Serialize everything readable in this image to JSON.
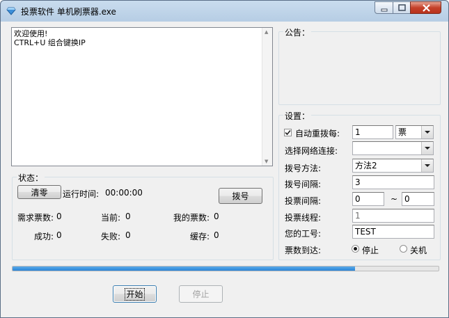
{
  "window": {
    "title": "投票软件 单机刷票器.exe",
    "accent": "#2a84d6"
  },
  "log": {
    "lines": "欢迎使用!\nCTRL+U 组合键换IP"
  },
  "announcement": {
    "label": "公告："
  },
  "status": {
    "label": "状态：",
    "clear_button": "清零",
    "runtime_label": "运行时间:",
    "runtime_value": "00:00:00",
    "dial_button": "拨号",
    "required_votes_label": "需求票数:",
    "required_votes_value": "0",
    "current_label": "当前:",
    "current_value": "0",
    "my_votes_label": "我的票数:",
    "my_votes_value": "0",
    "success_label": "成功:",
    "success_value": "0",
    "fail_label": "失败:",
    "fail_value": "0",
    "cache_label": "缓存:",
    "cache_value": "0"
  },
  "settings": {
    "label": "设置：",
    "auto_redial_label": "自动重拨每:",
    "auto_redial_checked": true,
    "auto_redial_value": "1",
    "auto_redial_unit": "票",
    "network_label": "选择网络连接:",
    "network_value": "",
    "dial_method_label": "拨号方法:",
    "dial_method_value": "方法2",
    "dial_interval_label": "拨号间隔:",
    "dial_interval_value": "3",
    "vote_interval_label": "投票间隔:",
    "vote_interval_min": "0",
    "vote_interval_sep": "~",
    "vote_interval_max": "0",
    "threads_label": "投票线程:",
    "threads_value": "1",
    "worker_id_label": "您的工号:",
    "worker_id_value": "TEST",
    "on_reach_label": "票数到达:",
    "option_stop": "停止",
    "option_shutdown": "关机",
    "selected_option": "停止"
  },
  "progress": {
    "fraction": 0.804
  },
  "buttons": {
    "start": "开始",
    "stop": "停止"
  }
}
